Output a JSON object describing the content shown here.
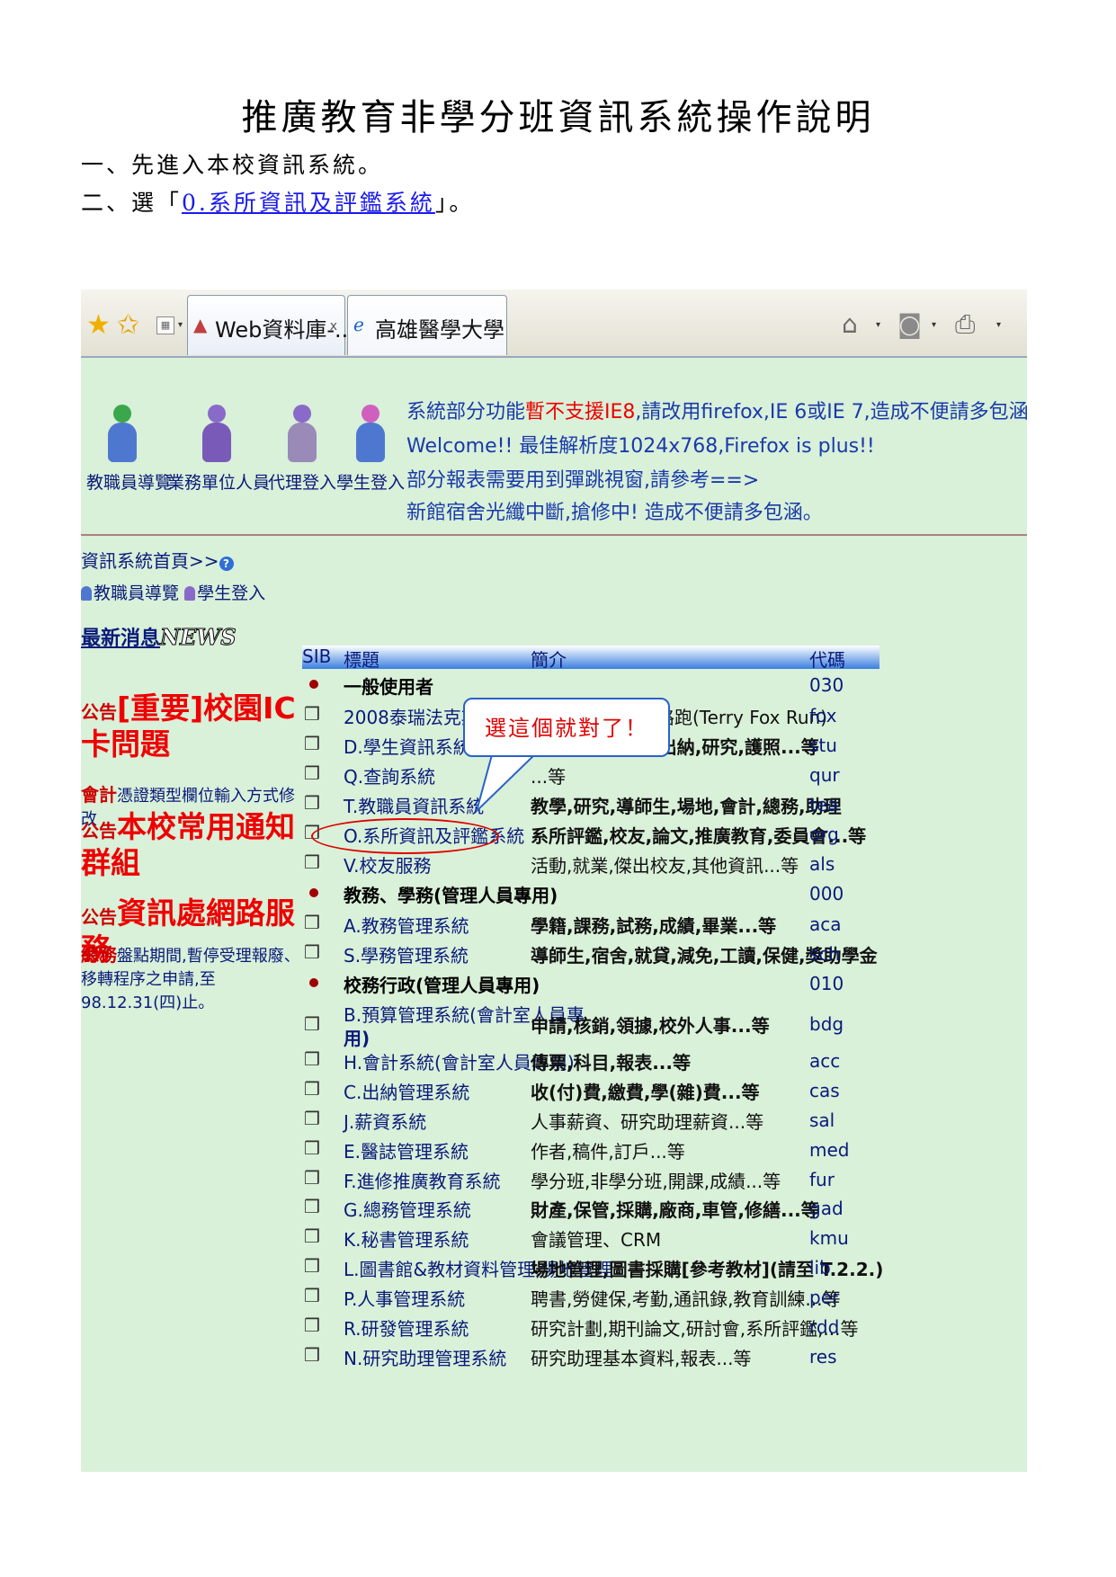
{
  "document": {
    "title": "推廣教育非學分班資訊系統操作說明",
    "step1": "一、先進入本校資訊系統。",
    "step2_prefix": "二、選「",
    "step2_link": "0.系所資訊及評鑑系統",
    "step2_suffix": "」。"
  },
  "browser": {
    "tab1": "Web資料庫-...",
    "tab1_close": "x",
    "tab2": "高雄醫學大學",
    "icons": [
      "favorites-star-icon",
      "add-favorites-icon",
      "quick-tabs-icon",
      "home-icon",
      "rss-feed-icon",
      "print-icon"
    ]
  },
  "portal": {
    "nav": [
      "教職員導覽",
      "業務單位人員",
      "代理登入",
      "學生登入"
    ],
    "notice1_a": "系統部分功能",
    "notice1_b": "暫不支援IE8",
    "notice1_c": ",請改用firefox,IE 6或IE 7,造成不便請多包涵!!",
    "notice2": "Welcome!! 最佳解析度1024x768,Firefox is plus!!",
    "notice3": "部分報表需要用到彈跳視窗,請參考==>",
    "notice4": "新館宿舍光纖中斷,搶修中! 造成不便請多包涵。",
    "home_link": "資訊系統首頁>>",
    "help": "?",
    "link_staff": "教職員導覽",
    "link_student": "學生登入",
    "news_zh": "最新消息",
    "news_en": "NEWS",
    "news": [
      {
        "tag": "公告",
        "text": "[重要]校園IC卡問題"
      },
      {
        "tag": "會計",
        "text": "憑證類型欄位輸入方式修改"
      },
      {
        "tag": "公告",
        "text": "本校常用通知群組"
      },
      {
        "tag": "公告",
        "text": "資訊處網路服務"
      },
      {
        "tag": "總務",
        "text": "盤點期間,暫停受理報廢、移轉程序之申請,至98.12.31(四)止。"
      }
    ],
    "callout": "選這個就對了！"
  },
  "table": {
    "headers": [
      "SIB",
      "標題",
      "簡介",
      "代碼"
    ],
    "rows": [
      {
        "icon": "bullet",
        "title": "一般使用者",
        "intro": "",
        "code": "030"
      },
      {
        "icon": "doc",
        "title": "2008泰瑞法克斯慈善路跑",
        "intro": "泰瑞法克斯慈善路跑(Terry Fox Run)",
        "code": "fox"
      },
      {
        "icon": "doc",
        "title": "D.學生資訊系統",
        "intro": "教務,學務,總務,出納,研究,護照...等",
        "code": "stu"
      },
      {
        "icon": "doc",
        "title": "Q.查詢系統",
        "intro": "...等",
        "code": "qur"
      },
      {
        "icon": "doc",
        "title": "T.教職員資訊系統",
        "intro": "教學,研究,導師生,場地,會計,總務,助理",
        "code": "tea"
      },
      {
        "icon": "doc",
        "title": "O.系所資訊及評鑑系統",
        "intro": "系所評鑑,校友,論文,推廣教育,委員會...等",
        "code": "org"
      },
      {
        "icon": "doc",
        "title": "V.校友服務",
        "intro": "活動,就業,傑出校友,其他資訊...等",
        "code": "als"
      },
      {
        "icon": "bullet",
        "title": "教務、學務(管理人員專用)",
        "intro": "",
        "code": "000"
      },
      {
        "icon": "doc",
        "title": "A.教務管理系統",
        "intro": "學籍,課務,試務,成績,畢業...等",
        "code": "aca"
      },
      {
        "icon": "doc",
        "title": "S.學務管理系統",
        "intro": "導師生,宿舍,就貸,減免,工讀,保健,獎助學金",
        "code": "sch"
      },
      {
        "icon": "bullet",
        "title": "校務行政(管理人員專用)",
        "intro": "",
        "code": "010"
      },
      {
        "icon": "doc",
        "title": "B.預算管理系統(會計室人員專",
        "title2": "用)",
        "intro": "申請,核銷,領據,校外人事...等",
        "code": "bdg"
      },
      {
        "icon": "doc",
        "title": "H.會計系統(會計室人員專用)",
        "intro": "傳票,科目,報表...等",
        "code": "acc"
      },
      {
        "icon": "doc",
        "title": "C.出納管理系統",
        "intro": "收(付)費,繳費,學(雜)費...等",
        "code": "cas"
      },
      {
        "icon": "doc",
        "title": "J.薪資系統",
        "intro": "人事薪資、研究助理薪資...等",
        "code": "sal"
      },
      {
        "icon": "doc",
        "title": "E.醫誌管理系統",
        "intro": "作者,稿件,訂戶...等",
        "code": "med"
      },
      {
        "icon": "doc",
        "title": "F.進修推廣教育系統",
        "intro": "學分班,非學分班,開課,成績...等",
        "code": "fur"
      },
      {
        "icon": "doc",
        "title": "G.總務管理系統",
        "intro": "財產,保管,採購,廠商,車管,修繕...等",
        "code": "gad"
      },
      {
        "icon": "doc",
        "title": "K.秘書管理系統",
        "intro": "會議管理、CRM",
        "code": "kmu"
      },
      {
        "icon": "doc",
        "title": "L.圖書館&教材資料管理,場地管理",
        "intro": "場地管理,圖書採購[參考教材](請至 T.2.2.)",
        "code": "lib"
      },
      {
        "icon": "doc",
        "title": "P.人事管理系統",
        "intro": "聘書,勞健保,考勤,通訊錄,教育訓練...等",
        "code": "per"
      },
      {
        "icon": "doc",
        "title": "R.研發管理系統",
        "intro": "研究計劃,期刊論文,研討會,系所評鑑,...等",
        "code": "rdd"
      },
      {
        "icon": "doc",
        "title": "N.研究助理管理系統",
        "intro": "研究助理基本資料,報表...等",
        "code": "res"
      }
    ]
  },
  "colors": {
    "link": "#0a1a7a",
    "alert": "#ee0000",
    "page_bg": "#d9f0d9",
    "callout_border": "#2a62c8"
  }
}
